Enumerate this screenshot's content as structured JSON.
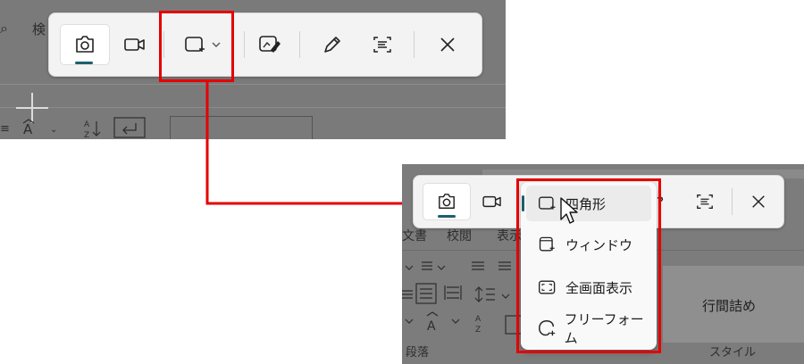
{
  "top_background": {
    "search_label": "検",
    "ribbon_icons": [
      "text-effects-icon",
      "sort-icon",
      "line-break-icon"
    ]
  },
  "snip_toolbar": {
    "items": [
      {
        "name": "camera-icon",
        "label": "",
        "active": true
      },
      {
        "name": "video-icon",
        "label": "",
        "active": false
      },
      {
        "name": "rectangle-snip-icon",
        "label": "",
        "active": false
      },
      {
        "name": "edit-image-icon",
        "label": "",
        "active": false
      },
      {
        "name": "pen-icon",
        "label": "",
        "active": false
      },
      {
        "name": "text-extract-icon",
        "label": "",
        "active": false
      },
      {
        "name": "close-icon",
        "label": "",
        "active": false
      }
    ]
  },
  "snip_mode_menu": {
    "items": [
      {
        "label": "四角形",
        "icon": "rectangle-snip-icon",
        "selected": true
      },
      {
        "label": "ウィンドウ",
        "icon": "window-snip-icon",
        "selected": false
      },
      {
        "label": "全画面表示",
        "icon": "fullscreen-snip-icon",
        "selected": false
      },
      {
        "label": "フリーフォーム",
        "icon": "freeform-snip-icon",
        "selected": false
      }
    ]
  },
  "bottom_background": {
    "tabs": [
      "文書",
      "校閲",
      "表示"
    ],
    "ribbon_button": "行間詰め",
    "group_labels": [
      "段落",
      "スタイル"
    ]
  },
  "colors": {
    "highlight_red": "#e60000",
    "accent_teal": "#1c5f6e",
    "toolbar_bg": "#f3f3f3",
    "dim_bg": "#7a7a7a"
  }
}
